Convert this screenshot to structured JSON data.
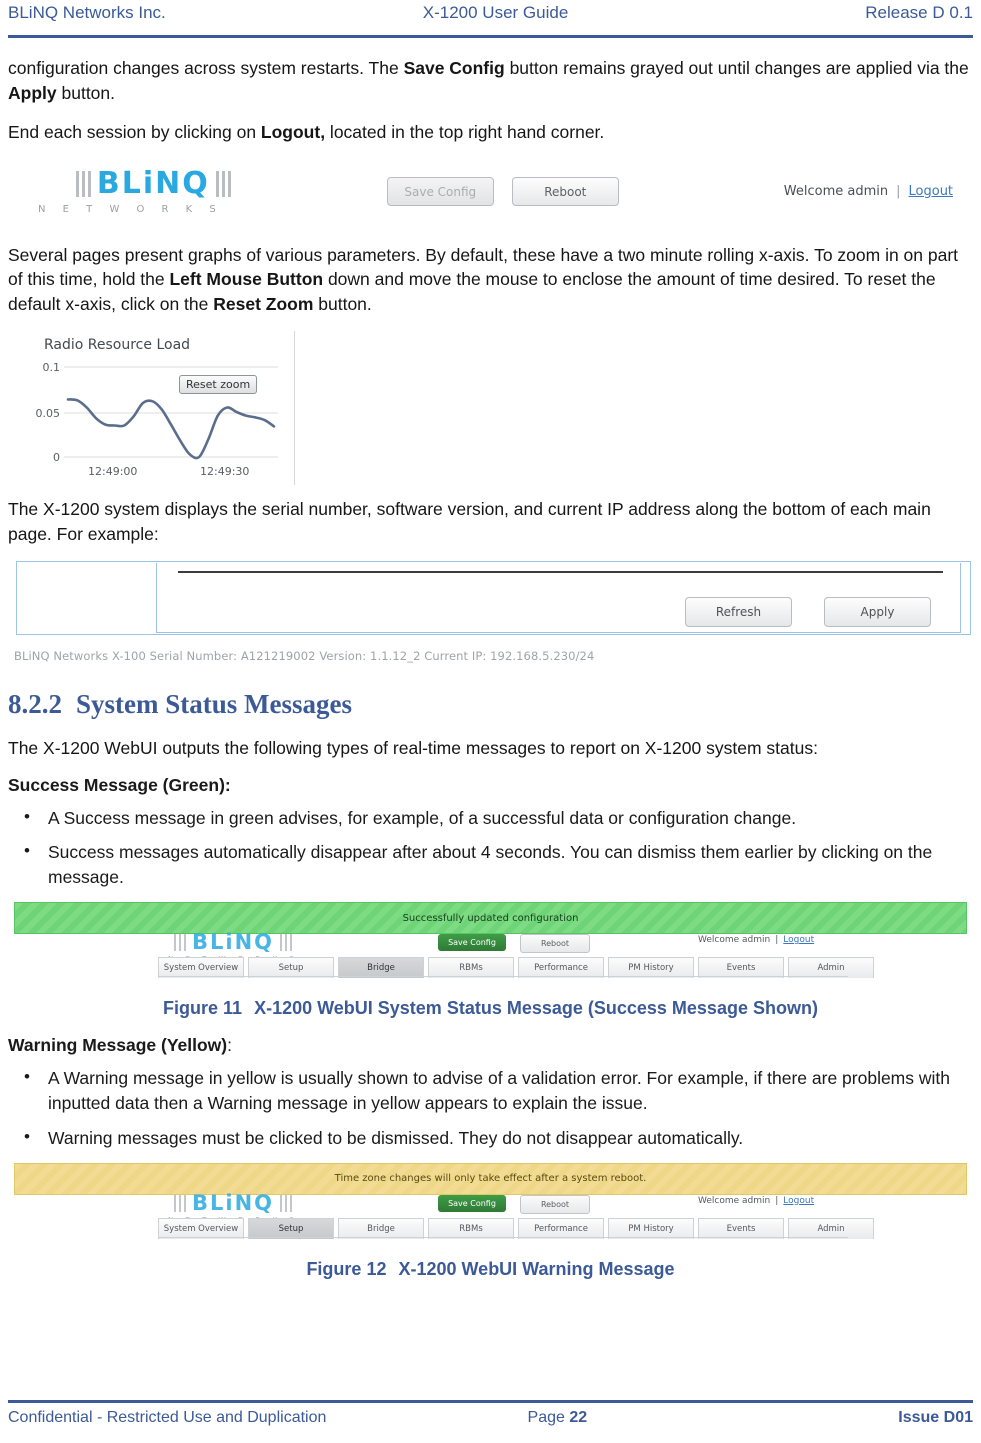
{
  "header": {
    "left": "BLiNQ Networks Inc.",
    "center": "X-1200 User Guide",
    "right": "Release D 0.1"
  },
  "body": {
    "para1_a": "configuration changes across system restarts. The ",
    "para1_b": "Save Config",
    "para1_c": " button remains grayed out until changes are applied via the ",
    "para1_d": "Apply",
    "para1_e": " button.",
    "para2_a": "End each session by clicking on ",
    "para2_b": "Logout,",
    "para2_c": " located in the top right hand corner.",
    "para3_a": "Several pages present graphs of various parameters. By default, these have a two minute rolling x-axis. To zoom in on part of this time, hold the ",
    "para3_b": "Left Mouse Button",
    "para3_c": " down and move the mouse to enclose the amount of time desired. To reset the default x-axis, click on the ",
    "para3_d": "Reset Zoom",
    "para3_e": " button.",
    "para4": "The X-1200 system displays the serial number, software version, and current IP address along the bottom of each main page. For example:",
    "para5": "The X-1200 WebUI outputs the following types of real-time messages to report on X-1200 system status:"
  },
  "heading": {
    "number": "8.2.2",
    "text": "System Status Messages"
  },
  "ui_header": {
    "logo_text": "BLiNQ",
    "logo_sub": "N E T W O R K S",
    "save_config": "Save Config",
    "reboot": "Reboot",
    "welcome": "Welcome admin",
    "separator": "|",
    "logout": "Logout"
  },
  "chart_data": {
    "type": "line",
    "title": "Radio Resource Load",
    "xlabel": "",
    "ylabel": "",
    "ylim": [
      0,
      0.1
    ],
    "ytick_labels": [
      "0.1",
      "0.05",
      "0"
    ],
    "ytick_values": [
      0.1,
      0.05,
      0
    ],
    "xtick_labels": [
      "12:49:00",
      "12:49:30"
    ],
    "grid": true,
    "legend": "none",
    "reset_zoom_label": "Reset zoom",
    "series": [
      {
        "name": "Radio Resource Load",
        "color": "#5a6e8c",
        "x": [
          0,
          1,
          2,
          3,
          4,
          5,
          6,
          7,
          8,
          9,
          10,
          11,
          12,
          13,
          14,
          15,
          16,
          17,
          18,
          19,
          20,
          21,
          22
        ],
        "values": [
          0.064,
          0.063,
          0.055,
          0.043,
          0.036,
          0.035,
          0.035,
          0.045,
          0.06,
          0.062,
          0.053,
          0.036,
          0.018,
          0.003,
          0.0,
          0.02,
          0.046,
          0.055,
          0.05,
          0.046,
          0.044,
          0.041,
          0.034
        ]
      }
    ]
  },
  "panel": {
    "refresh": "Refresh",
    "apply": "Apply",
    "status_line": "BLiNQ Networks X-100 Serial Number: A121219002 Version: 1.1.12_2 Current IP: 192.168.5.230/24"
  },
  "success": {
    "label": "Success Message (Green):",
    "bullets": [
      "A Success message in green advises, for example, of a successful data or configuration change.",
      "Success messages automatically disappear after about 4 seconds. You can dismiss them earlier by clicking on the message."
    ],
    "banner_text": "Successfully updated configuration",
    "banner_color": "#6fd477",
    "caption_num": "Figure 11",
    "caption_text": "X-1200 WebUI System Status Message (Success Message Shown)",
    "active_tab": "Bridge"
  },
  "warning": {
    "label_a": "Warning Message (Yellow)",
    "label_b": ":",
    "bullets": [
      "A Warning message in yellow is usually shown to advise of a validation error. For example, if there are problems with inputted data then a Warning message in yellow appears to explain the issue.",
      "Warning messages must be clicked to be dismissed. They do not disappear automatically."
    ],
    "banner_text": "Time zone changes will only take effect after a system reboot.",
    "banner_color": "#eed887",
    "caption_num": "Figure 12",
    "caption_text": "X-1200 WebUI Warning Message",
    "active_tab": "Setup"
  },
  "webui_tabs": [
    "System Overview",
    "Setup",
    "Bridge",
    "RBMs",
    "Performance",
    "PM History",
    "Events",
    "Admin"
  ],
  "webui_buttons": {
    "save_config": "Save Config",
    "reboot": "Reboot",
    "welcome": "Welcome admin",
    "separator": "|",
    "logout": "Logout"
  },
  "footer": {
    "left": "Confidential - Restricted Use and Duplication",
    "center_label": "Page ",
    "center_number": "22",
    "right": "Issue D01"
  }
}
